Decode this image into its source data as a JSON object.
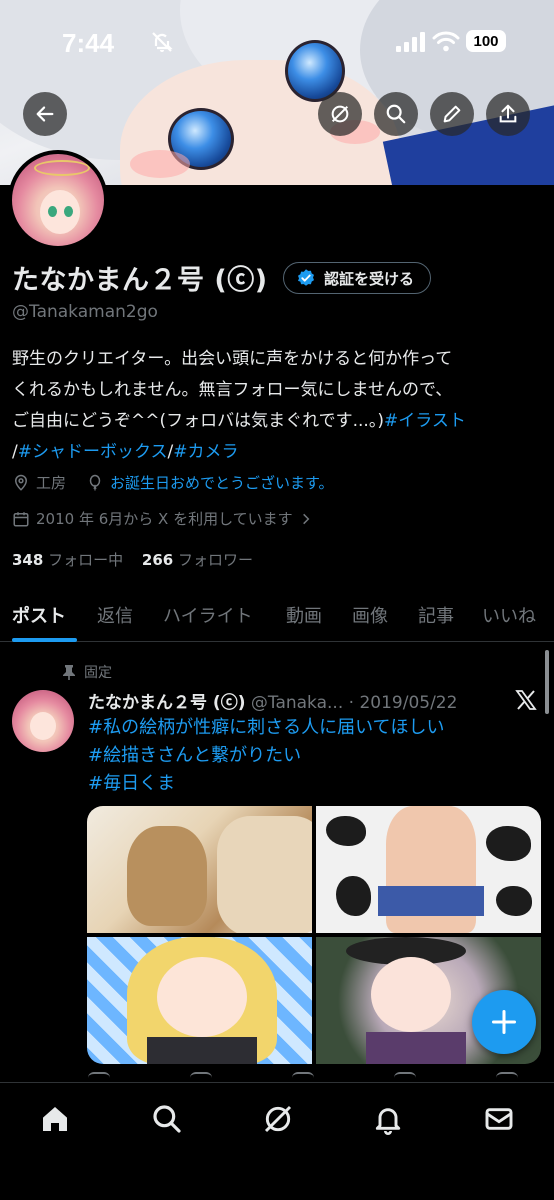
{
  "status_bar": {
    "time": "7:44",
    "battery": "100"
  },
  "profile": {
    "display_name": "たなかまん２号 (ⓒ)",
    "verify_button": "認証を受ける",
    "handle": "@Tanakaman2go",
    "bio_lines": [
      "野生のクリエイター。出会い頭に声をかけると何か作って",
      "くれるかもしれません。無言フォロー気にしませんので、",
      "ご自由にどうぞ^^(フォロバは気まぐれです...。)"
    ],
    "bio_tags": [
      "#イラスト",
      "#シャドーボックス",
      "#カメラ"
    ],
    "location": "工房",
    "birthday": "お誕生日おめでとうございます。",
    "joined": "2010 年 6月から X を利用しています",
    "following_count": "348",
    "following_label": "フォロー中",
    "followers_count": "266",
    "followers_label": "フォロワー"
  },
  "tabs": [
    "ポスト",
    "返信",
    "ハイライト",
    "動画",
    "画像",
    "記事",
    "いいね"
  ],
  "pinned_tweet": {
    "pinned_label": "固定",
    "author_name": "たなかまん２号 (ⓒ)",
    "author_handle": "@Tanaka...",
    "separator": "·",
    "date": "2019/05/22",
    "lines": [
      "#私の絵柄が性癖に刺さる人に届いてほしい",
      "#絵描きさんと繋がりたい",
      "#毎日くま"
    ]
  },
  "colors": {
    "accent": "#1d9bf0",
    "background": "#000000",
    "secondary_text": "#71767b"
  },
  "icons": {
    "back": "arrow-left-icon",
    "grok": "grok-icon",
    "search": "search-icon",
    "edit": "pencil-icon",
    "share": "share-icon",
    "compose": "plus-icon",
    "home": "home-icon",
    "notifications": "bell-icon",
    "messages": "mail-icon"
  }
}
